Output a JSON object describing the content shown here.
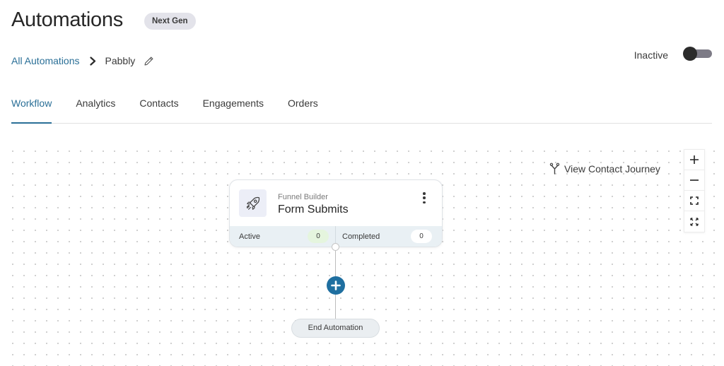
{
  "header": {
    "title": "Automations",
    "badge": "Next Gen"
  },
  "breadcrumb": {
    "parent": "All Automations",
    "current": "Pabbly",
    "separator_icon": "chevron-right-icon",
    "edit_icon": "pencil-icon"
  },
  "status": {
    "label": "Inactive",
    "enabled": false
  },
  "tabs": [
    {
      "label": "Workflow",
      "active": true
    },
    {
      "label": "Analytics",
      "active": false
    },
    {
      "label": "Contacts",
      "active": false
    },
    {
      "label": "Engagements",
      "active": false
    },
    {
      "label": "Orders",
      "active": false
    }
  ],
  "canvas": {
    "journey_link": "View Contact Journey",
    "journey_icon": "fork-icon",
    "zoom_controls": [
      {
        "name": "zoom-in",
        "icon": "plus-icon"
      },
      {
        "name": "zoom-out",
        "icon": "minus-icon"
      },
      {
        "name": "fit-view",
        "icon": "frame-corners-icon"
      },
      {
        "name": "fullscreen",
        "icon": "expand-arrows-icon"
      }
    ]
  },
  "trigger_node": {
    "icon": "rocket-icon",
    "app": "Funnel Builder",
    "title": "Form Submits",
    "stats": {
      "active_label": "Active",
      "active_count": "0",
      "completed_label": "Completed",
      "completed_count": "0"
    }
  },
  "end_node": {
    "label": "End Automation"
  },
  "colors": {
    "accent": "#2a6f97",
    "add_button": "#1f6fa0",
    "toggle_knob": "#2b2b2b",
    "toggle_track": "#7d7b86",
    "active_pill": "#e5f5de",
    "stats_bar": "#e9f0f4"
  }
}
